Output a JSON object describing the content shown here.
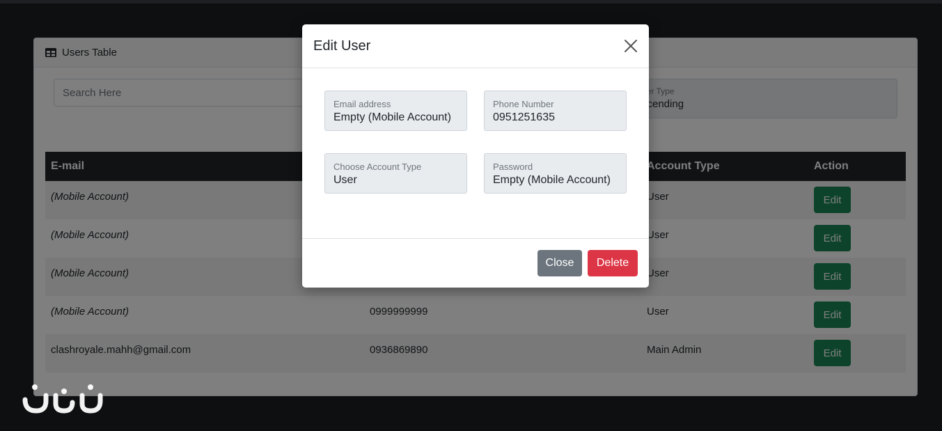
{
  "card": {
    "title": "Users Table",
    "search_placeholder": "Search Here",
    "order_label": "der Type",
    "order_value": "scending"
  },
  "table": {
    "headers": [
      "E-mail",
      "Account Type",
      "Action"
    ],
    "rows": [
      {
        "email": "(Mobile Account)",
        "phone": "",
        "type": "User",
        "action": "Edit"
      },
      {
        "email": "(Mobile Account)",
        "phone": "",
        "type": "User",
        "action": "Edit"
      },
      {
        "email": "(Mobile Account)",
        "phone": "",
        "type": "User",
        "action": "Edit"
      },
      {
        "email": "(Mobile Account)",
        "phone": "0999999999",
        "type": "User",
        "action": "Edit"
      },
      {
        "email": "clashroyale.mahh@gmail.com",
        "phone": "0936869890",
        "type": "Main Admin",
        "action": "Edit"
      }
    ]
  },
  "modal": {
    "title": "Edit User",
    "fields": {
      "email": {
        "label": "Email address",
        "value": "Empty (Mobile Account)"
      },
      "phone": {
        "label": "Phone Number",
        "value": "0951251635"
      },
      "account_type": {
        "label": "Choose Account Type",
        "value": "User"
      },
      "password": {
        "label": "Password",
        "value": "Empty (Mobile Account)"
      }
    },
    "close_label": "Close",
    "delete_label": "Delete"
  },
  "colors": {
    "header_dark": "#212529",
    "edit_green": "#198754",
    "delete_red": "#dc3545",
    "close_gray": "#6c757d"
  }
}
